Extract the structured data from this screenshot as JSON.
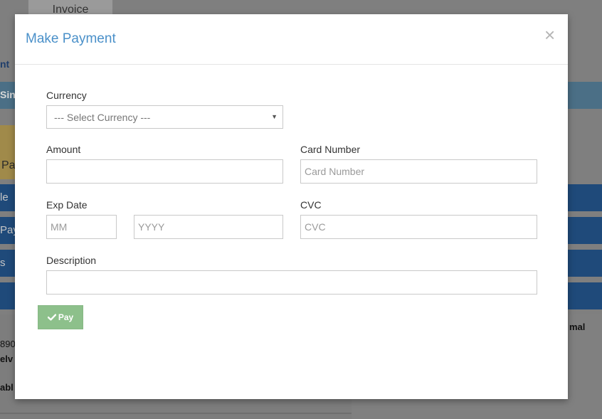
{
  "background": {
    "tab_label": "Invoice",
    "link_fragment": "nt",
    "band_fragment": "Sinc",
    "yellow_fragment": "Pa",
    "blue_rows": [
      "le",
      "Pay",
      "s",
      ""
    ],
    "left_text_lines": [
      "890",
      "elv",
      "abl"
    ],
    "right_text": "mal"
  },
  "modal": {
    "title": "Make Payment",
    "close_symbol": "×",
    "currency": {
      "label": "Currency",
      "selected": "--- Select Currency ---",
      "caret": "▼"
    },
    "amount": {
      "label": "Amount",
      "value": "",
      "placeholder": ""
    },
    "card_number": {
      "label": "Card Number",
      "value": "",
      "placeholder": "Card Number"
    },
    "exp_date": {
      "label": "Exp Date",
      "month_placeholder": "MM",
      "year_placeholder": "YYYY"
    },
    "cvc": {
      "label": "CVC",
      "value": "",
      "placeholder": "CVC"
    },
    "description": {
      "label": "Description",
      "value": "",
      "placeholder": ""
    },
    "pay_button": {
      "label": "Pay",
      "icon": "check-icon",
      "color": "#8dc08b"
    }
  },
  "colors": {
    "title": "#4a90c9",
    "overlay": "#7f7f7f"
  }
}
